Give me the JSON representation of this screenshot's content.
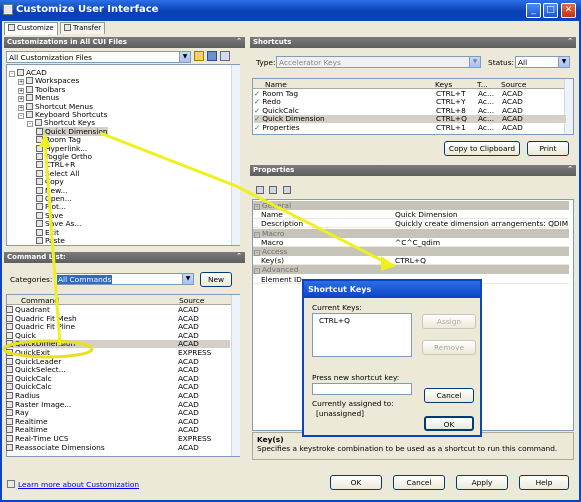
{
  "window": {
    "title": "Customize User Interface"
  },
  "tabs": [
    {
      "label": "Customize"
    },
    {
      "label": "Transfer"
    }
  ],
  "customizations": {
    "header": "Customizations in All CUI Files",
    "file_combo": "All Customization Files",
    "tree": [
      {
        "label": "ACAD",
        "level": 0,
        "exp": "-"
      },
      {
        "label": "Workspaces",
        "level": 1,
        "exp": "+"
      },
      {
        "label": "Toolbars",
        "level": 1,
        "exp": "+"
      },
      {
        "label": "Menus",
        "level": 1,
        "exp": "+"
      },
      {
        "label": "Shortcut Menus",
        "level": 1,
        "exp": "+"
      },
      {
        "label": "Keyboard Shortcuts",
        "level": 1,
        "exp": "-"
      },
      {
        "label": "Shortcut Keys",
        "level": 2,
        "exp": "-"
      },
      {
        "label": "Quick Dimension",
        "level": 3,
        "sel": true
      },
      {
        "label": "Room Tag",
        "level": 3
      },
      {
        "label": "Hyperlink...",
        "level": 3
      },
      {
        "label": "Toggle Ortho",
        "level": 3
      },
      {
        "label": "CTRL+R",
        "level": 3
      },
      {
        "label": "Select All",
        "level": 3
      },
      {
        "label": "Copy",
        "level": 3
      },
      {
        "label": "New...",
        "level": 3
      },
      {
        "label": "Open...",
        "level": 3
      },
      {
        "label": "Plot...",
        "level": 3
      },
      {
        "label": "Save",
        "level": 3
      },
      {
        "label": "Save As...",
        "level": 3
      },
      {
        "label": "Exit",
        "level": 3
      },
      {
        "label": "Paste",
        "level": 3
      }
    ]
  },
  "commands": {
    "header": "Command List:",
    "categories_label": "Categories:",
    "categories_value": "All Commands",
    "new_button": "New",
    "col_command": "Command",
    "col_source": "Source",
    "rows": [
      {
        "name": "Quadrant",
        "source": "ACAD"
      },
      {
        "name": "Quadric Fit Mesh",
        "source": "ACAD"
      },
      {
        "name": "Quadric Fit Pline",
        "source": "ACAD"
      },
      {
        "name": "Quick",
        "source": "ACAD"
      },
      {
        "name": "QuickDimension",
        "source": "ACAD",
        "sel": true
      },
      {
        "name": "QuickExit",
        "source": "EXPRESS"
      },
      {
        "name": "QuickLeader",
        "source": "ACAD"
      },
      {
        "name": "QuickSelect...",
        "source": "ACAD"
      },
      {
        "name": "QuickCalc",
        "source": "ACAD"
      },
      {
        "name": "QuickCalc",
        "source": "ACAD"
      },
      {
        "name": "Radius",
        "source": "ACAD"
      },
      {
        "name": "Raster Image...",
        "source": "ACAD"
      },
      {
        "name": "Ray",
        "source": "ACAD"
      },
      {
        "name": "Realtime",
        "source": "ACAD"
      },
      {
        "name": "Realtime",
        "source": "ACAD"
      },
      {
        "name": "Real-Time UCS",
        "source": "EXPRESS"
      },
      {
        "name": "Reassociate Dimensions",
        "source": "ACAD"
      }
    ],
    "learn_link": "Learn more about Customization"
  },
  "shortcuts": {
    "header": "Shortcuts",
    "type_label": "Type:",
    "type_value": "Accelerator Keys",
    "status_label": "Status:",
    "status_value": "All",
    "col_name": "Name",
    "col_keys": "Keys",
    "col_t": "T...",
    "col_source": "Source",
    "rows": [
      {
        "name": "Room Tag",
        "keys": "CTRL+T",
        "t": "Ac...",
        "source": "ACAD"
      },
      {
        "name": "Redo",
        "keys": "CTRL+Y",
        "t": "Ac...",
        "source": "ACAD"
      },
      {
        "name": "QuickCalc",
        "keys": "CTRL+8",
        "t": "Ac...",
        "source": "ACAD"
      },
      {
        "name": "Quick Dimension",
        "keys": "CTRL+Q",
        "t": "Ac...",
        "source": "ACAD",
        "sel": true
      },
      {
        "name": "Properties",
        "keys": "CTRL+1",
        "t": "Ac...",
        "source": "ACAD"
      }
    ],
    "copy_button": "Copy to Clipboard",
    "print_button": "Print"
  },
  "properties": {
    "header": "Properties",
    "rows": [
      {
        "cat": true,
        "k": "General"
      },
      {
        "k": "Name",
        "v": "Quick Dimension"
      },
      {
        "k": "Description",
        "v": "Quickly create dimension arrangements:  QDIM"
      },
      {
        "cat": true,
        "k": "Macro"
      },
      {
        "k": "Macro",
        "v": "^C^C_qdim"
      },
      {
        "cat": true,
        "k": "Access"
      },
      {
        "k": "Key(s)",
        "v": "CTRL+Q"
      },
      {
        "cat": true,
        "k": "Advanced"
      },
      {
        "k": "Element ID",
        "v": ""
      }
    ],
    "help_title": "Key(s)",
    "help_text": "Specifies a keystroke combination to be used as a shortcut to run this command."
  },
  "dialog": {
    "title": "Shortcut Keys",
    "current_keys_label": "Current Keys:",
    "current_key": "CTRL+Q",
    "assign": "Assign",
    "remove": "Remove",
    "press_label": "Press new shortcut key:",
    "assigned_label": "Currently assigned to:",
    "assigned_value": "[unassigned]",
    "cancel": "Cancel",
    "ok": "OK"
  },
  "footer": {
    "ok": "OK",
    "cancel": "Cancel",
    "apply": "Apply",
    "help": "Help"
  },
  "colors": {
    "titlebar": "#0b43c0",
    "annotation_arrow": "#f0f020",
    "panel_header": "#6b6b6b"
  }
}
